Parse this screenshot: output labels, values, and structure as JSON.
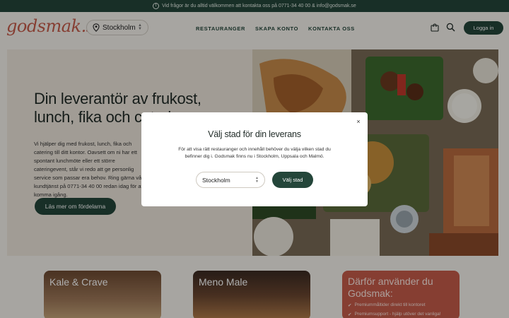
{
  "topbar": {
    "text": "Vid frågor är du alltid välkommen att kontakta oss på 0771-34 40 00 & info@godsmak.se"
  },
  "header": {
    "logo": "godsmak.se",
    "city_select_value": "Stockholm",
    "nav": [
      "RESTAURANGER",
      "SKAPA KONTO",
      "KONTAKTA OSS"
    ],
    "login_label": "Logga in"
  },
  "hero": {
    "title": "Din leverantör av frukost, lunch, fika och catering",
    "text": "Vi hjälper dig med frukost, lunch, fika och catering till ditt kontor. Oavsett om ni har ett spontant lunchmöte eller ett större cateringevent, står vi redo att ge personlig service som passar era behov. Ring gärna vår kundtjänst på 0771-34 40 00 redan idag för att komma igång.",
    "button_label": "Läs mer om fördelarna"
  },
  "cards": {
    "kale": "Kale & Crave",
    "meno": "Meno Male",
    "why_title": "Därför använder du Godsmak:",
    "why_bullets": [
      "Premiummåltider direkt till kontoret",
      "Premiumsupport - hjälp utöver det vanliga!"
    ]
  },
  "modal": {
    "title": "Välj stad för din leverans",
    "text": "För att visa rätt restauranger och innehåll behöver du välja vilken stad du befinner dig i. Godsmak finns nu i Stockholm, Uppsala och Malmö.",
    "select_value": "Stockholm",
    "button_label": "Välj stad",
    "close_symbol": "×"
  },
  "colors": {
    "brand_green": "#24463a",
    "brand_coral": "#c65c4b",
    "background": "#f6f3ee"
  }
}
